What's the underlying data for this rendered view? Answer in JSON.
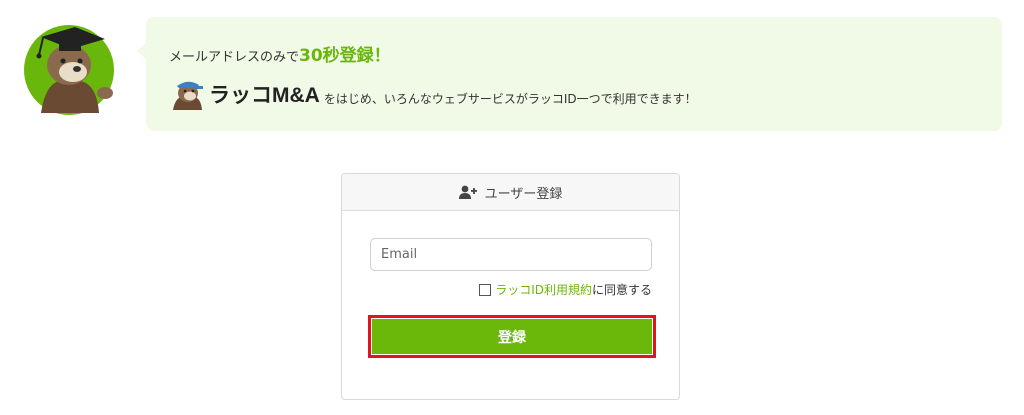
{
  "banner": {
    "line1_prefix": "メールアドレスのみで",
    "line1_highlight": "30秒登録！",
    "brand_name": "ラッコM&A",
    "line2_text": "をはじめ、いろんなウェブサービスがラッコID一つで利用できます！"
  },
  "card": {
    "header_title": "ユーザー登録",
    "email_placeholder": "Email",
    "terms_link": "ラッコID利用規約",
    "terms_suffix": "に同意する",
    "submit_label": "登録"
  },
  "icons": {
    "mascot": "otter-graduate-mascot-icon",
    "brand": "otter-brand-icon",
    "header": "user-plus-icon"
  },
  "colors": {
    "accent": "#6ab70c",
    "button": "#6bb80b",
    "highlight_border": "#e5141b",
    "banner_bg": "#f0fae6"
  }
}
